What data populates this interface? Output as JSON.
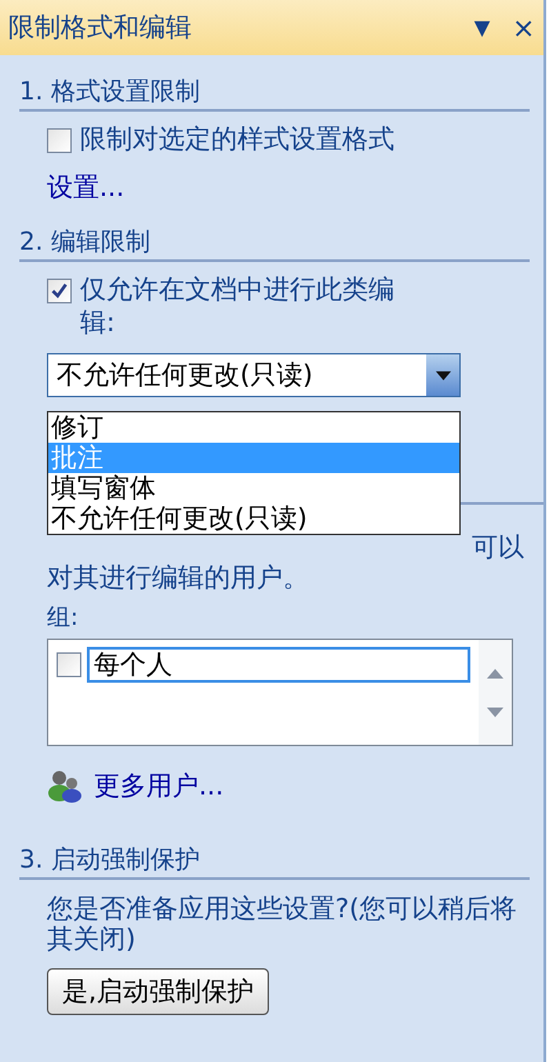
{
  "pane": {
    "title": "限制格式和编辑",
    "menu_glyph": "▼",
    "close_glyph": "×"
  },
  "formatting": {
    "heading": "1. 格式设置限制",
    "checkbox": {
      "label": "限制对选定的样式设置格式",
      "checked": false
    },
    "settings_link": "设置..."
  },
  "editing": {
    "heading": "2. 编辑限制",
    "checkbox": {
      "label": "仅允许在文档中进行此类编辑:",
      "checked": true
    },
    "dropdown": {
      "value": "不允许任何更改(只读)",
      "expanded": true,
      "options": [
        {
          "label": "修订",
          "highlighted": false
        },
        {
          "label": "批注",
          "highlighted": true
        },
        {
          "label": "填写窗体",
          "highlighted": false
        },
        {
          "label": "不允许任何更改(只读)",
          "highlighted": false
        }
      ]
    }
  },
  "exceptions": {
    "text_fragment_1": "可以",
    "text_fragment_2": "对其进行编辑的用户。",
    "groups_label": "组:",
    "groups": [
      {
        "label": "每个人",
        "checked": false
      }
    ],
    "more_users_link": "更多用户..."
  },
  "enforcement": {
    "heading": "3. 启动强制保护",
    "prompt": "您是否准备应用这些设置?(您可以稍后将其关闭)",
    "button": "是,启动强制保护"
  }
}
